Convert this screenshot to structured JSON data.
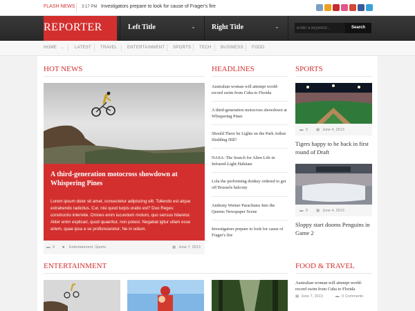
{
  "flash": {
    "label": "FLASH NEWS",
    "time": "3:17 PM",
    "text": "Investigators prepare to look for cause of Frager's fire"
  },
  "social_icons": [
    {
      "name": "email-icon",
      "color": "#7aa0c4"
    },
    {
      "name": "rss-icon",
      "color": "#f0a020"
    },
    {
      "name": "pinterest-icon",
      "color": "#c62d2d"
    },
    {
      "name": "dribbble-icon",
      "color": "#e0578b"
    },
    {
      "name": "google-plus-icon",
      "color": "#d34836"
    },
    {
      "name": "facebook-icon",
      "color": "#3b5998"
    },
    {
      "name": "twitter-icon",
      "color": "#38a1d8"
    }
  ],
  "header": {
    "logo": "REPORTER",
    "left_title": "Left Title",
    "right_title": "Right Title",
    "search_placeholder": "Enter a keyword...",
    "search_button": "Search"
  },
  "menu": [
    "HOME",
    "LATEST",
    "TRAVEL",
    "ENTERTAINMENT",
    "SPORTS",
    "TECH",
    "BUSINESS",
    "FOOD"
  ],
  "hot_news": {
    "title": "HOT NEWS",
    "headline": "A third-generation motocross showdown at Whispering Pines",
    "body": "Lorem ipsum dolor sit amet, consectetur adipiscing elit. Tollendo est atque extrahendo radicitus. Cur, nisi quod turpis oratio est? Duo Reges: constructio interrete. Omnes enim iucundum motum, quo sensus hilaretur. Aliter enim explicari, quod quaeritur, non potest. Negabat igitur ullam esse artem, quae ipsa a se proficisceretur; Ne in odium.",
    "comments": "0",
    "categories": "Entertainment, Sports",
    "date": "June 7, 2013"
  },
  "headlines": {
    "title": "HEADLINES",
    "items": [
      "Australian woman will attempt world-record swim from Cuba to Florida",
      "A third-generation motocross showdown at Whispering Pines",
      "Should There be Lights on the Park Arthur Sledding Hill?",
      "NASA: The Search for Alien Life in Infrared-Light Habitats",
      "Lola the performing donkey ordered to get off Brussels balcony",
      "Anthony Weiner Parachutes Into the Queens Newspaper Scene",
      "Investigators prepare to look for cause of Frager's fire"
    ]
  },
  "sports": {
    "title": "SPORTS",
    "items": [
      {
        "comments": "0",
        "date": "June 4, 2013",
        "title": "Tigers happy to be back in first round of Draft"
      },
      {
        "comments": "0",
        "date": "June 4, 2013",
        "title": "Sloppy start dooms Penguins in Game 2"
      }
    ]
  },
  "entertainment": {
    "title": "ENTERTAINMENT"
  },
  "food_travel": {
    "title": "FOOD & TRAVEL",
    "item": "Australian woman will attempt world-record swim from Cuba to Florida",
    "date": "June 7, 2013",
    "comments": "0 Comments"
  },
  "colors": {
    "accent": "#d32f2f",
    "header": "#2e2e2e"
  }
}
